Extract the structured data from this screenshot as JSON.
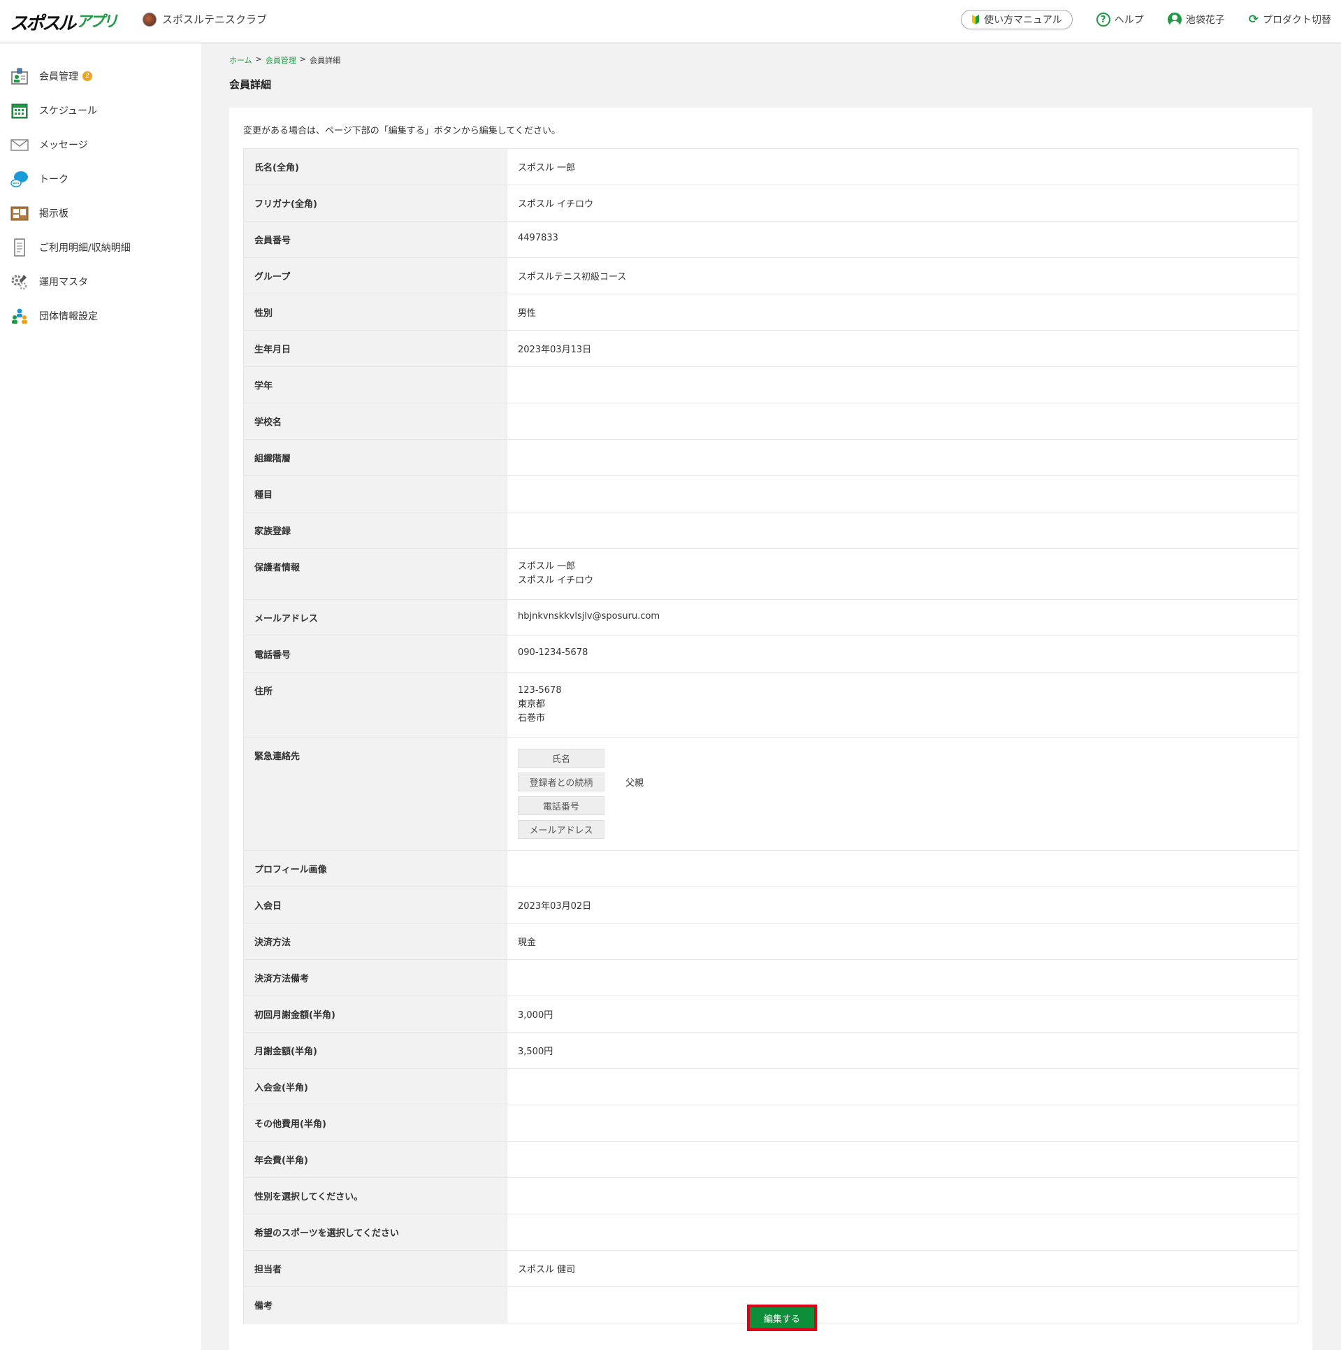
{
  "header": {
    "logo_text": "スポスルアプリ",
    "club_name": "スポスルテニスクラブ",
    "manual_label": "使い方マニュアル",
    "help_label": "ヘルプ",
    "user_name": "池袋花子",
    "switch_label": "プロダクト切替"
  },
  "sidebar": {
    "items": [
      {
        "label": "会員管理",
        "badge": "2",
        "icon": "members-icon"
      },
      {
        "label": "スケジュール",
        "icon": "calendar-icon"
      },
      {
        "label": "メッセージ",
        "icon": "envelope-icon"
      },
      {
        "label": "トーク",
        "icon": "chat-bubble-icon"
      },
      {
        "label": "掲示板",
        "icon": "bulletin-board-icon"
      },
      {
        "label": "ご利用明細/収納明細",
        "icon": "receipt-icon"
      },
      {
        "label": "運用マスタ",
        "icon": "gear-wrench-icon"
      },
      {
        "label": "団体情報設定",
        "icon": "group-settings-icon"
      }
    ]
  },
  "breadcrumb": {
    "home": "ホーム",
    "members": "会員管理",
    "current": "会員詳細",
    "sep": ">"
  },
  "page": {
    "title": "会員詳細",
    "note": "変更がある場合は、ページ下部の「編集する」ボタンから編集してください。",
    "edit_button": "編集する"
  },
  "fields": {
    "name": {
      "label": "氏名(全角)",
      "value": "スポスル 一郎"
    },
    "kana": {
      "label": "フリガナ(全角)",
      "value": "スポスル イチロウ"
    },
    "member_no": {
      "label": "会員番号",
      "value": "4497833"
    },
    "group": {
      "label": "グループ",
      "value": "スポスルテニス初級コース"
    },
    "gender": {
      "label": "性別",
      "value": "男性"
    },
    "birthday": {
      "label": "生年月日",
      "value": "2023年03月13日"
    },
    "grade": {
      "label": "学年",
      "value": ""
    },
    "school": {
      "label": "学校名",
      "value": ""
    },
    "org_level": {
      "label": "組織階層",
      "value": ""
    },
    "event": {
      "label": "種目",
      "value": ""
    },
    "family": {
      "label": "家族登録",
      "value": ""
    },
    "guardian": {
      "label": "保護者情報",
      "line1": "スポスル 一郎",
      "line2": "スポスル イチロウ"
    },
    "email": {
      "label": "メールアドレス",
      "value": "hbjnkvnskkvlsjlv@sposuru.com"
    },
    "phone": {
      "label": "電話番号",
      "value": "090-1234-5678"
    },
    "address": {
      "label": "住所",
      "line1": "123-5678",
      "line2": "東京都",
      "line3": "石巻市"
    },
    "emergency": {
      "label": "緊急連絡先",
      "name_label": "氏名",
      "name_value": "",
      "relation_label": "登録者との続柄",
      "relation_value": "父親",
      "phone_label": "電話番号",
      "phone_value": "",
      "email_label": "メールアドレス",
      "email_value": ""
    },
    "profile_image": {
      "label": "プロフィール画像",
      "value": ""
    },
    "join_date": {
      "label": "入会日",
      "value": "2023年03月02日"
    },
    "payment": {
      "label": "決済方法",
      "value": "現金"
    },
    "payment_note": {
      "label": "決済方法備考",
      "value": ""
    },
    "first_fee": {
      "label": "初回月謝金額(半角)",
      "value": "3,000円"
    },
    "monthly_fee": {
      "label": "月謝金額(半角)",
      "value": "3,500円"
    },
    "entry_fee": {
      "label": "入会金(半角)",
      "value": ""
    },
    "other_fee": {
      "label": "その他費用(半角)",
      "value": ""
    },
    "annual_fee": {
      "label": "年会費(半角)",
      "value": ""
    },
    "gender_select": {
      "label": "性別を選択してください。",
      "value": ""
    },
    "sport_select": {
      "label": "希望のスポーツを選択してください",
      "value": ""
    },
    "staff": {
      "label": "担当者",
      "value": "スポスル 健司"
    },
    "remarks": {
      "label": "備考",
      "value": ""
    }
  },
  "colors": {
    "accent": "#1f9a45",
    "button": "#0d8f3a",
    "highlight_border": "#e0001b",
    "badge": "#f0a21b"
  }
}
